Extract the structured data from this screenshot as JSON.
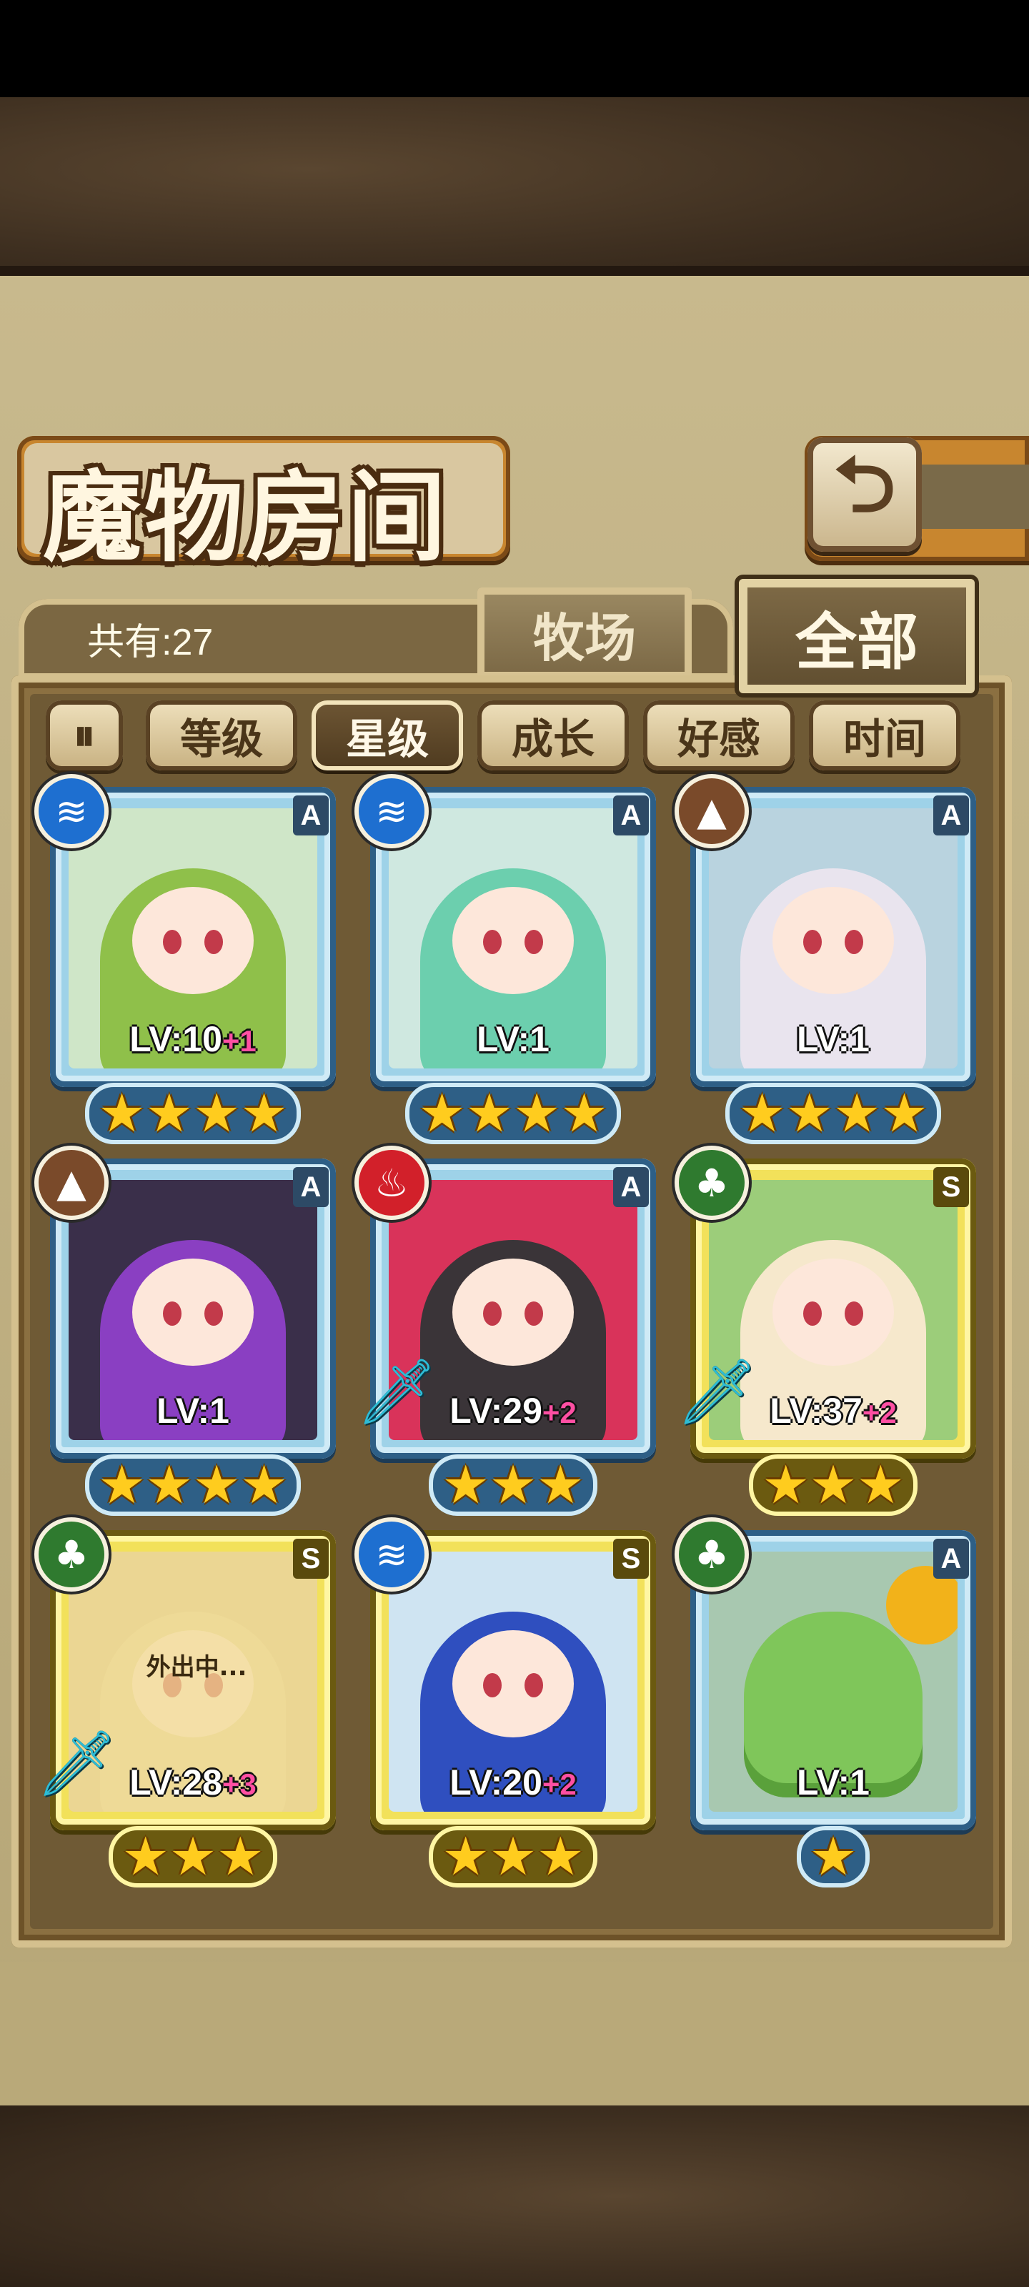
{
  "title": "魔物房间",
  "back_icon": "back-arrow-icon",
  "count_text": "共有:27",
  "tabs": [
    {
      "label": "牧场",
      "active": false
    },
    {
      "label": "全部",
      "active": true
    }
  ],
  "sort": {
    "toggle_icon": "sort-order-icon",
    "toggle_glyph": "⏸",
    "options": [
      {
        "label": "等级",
        "active": false
      },
      {
        "label": "星级",
        "active": true
      },
      {
        "label": "成长",
        "active": false
      },
      {
        "label": "好感",
        "active": false
      },
      {
        "label": "时间",
        "active": false
      }
    ]
  },
  "colors": {
    "accent": "#c8862f",
    "panel": "#6f5a35",
    "plus": "#ff4fa3",
    "star": "#ffcc1e"
  },
  "monsters": [
    {
      "element": "water",
      "rank": "A",
      "frame": "blue",
      "lv": "LV:10",
      "plus": "+1",
      "stars": 4,
      "art_bg": "#cfe6c8",
      "hair": "#8fc04a",
      "weapon": false,
      "away": false
    },
    {
      "element": "water",
      "rank": "A",
      "frame": "blue",
      "lv": "LV:1",
      "plus": "",
      "stars": 4,
      "art_bg": "#cfe8e0",
      "hair": "#6ccfae",
      "weapon": false,
      "away": false
    },
    {
      "element": "earth",
      "rank": "A",
      "frame": "blue",
      "lv": "LV:1",
      "plus": "",
      "stars": 4,
      "art_bg": "#b9d3df",
      "hair": "#e9e4ee",
      "weapon": false,
      "away": false
    },
    {
      "element": "earth",
      "rank": "A",
      "frame": "blue",
      "lv": "LV:1",
      "plus": "",
      "stars": 4,
      "art_bg": "#3a2f4a",
      "hair": "#8a3fc2",
      "weapon": false,
      "away": false
    },
    {
      "element": "fire",
      "rank": "A",
      "frame": "blue",
      "lv": "LV:29",
      "plus": "+2",
      "stars": 3,
      "art_bg": "#d9335a",
      "hair": "#3a3438",
      "weapon": true,
      "away": false
    },
    {
      "element": "wood",
      "rank": "S",
      "frame": "gold",
      "lv": "LV:37",
      "plus": "+2",
      "stars": 3,
      "art_bg": "#9ccd7a",
      "hair": "#f6e8cc",
      "weapon": true,
      "away": false
    },
    {
      "element": "wood",
      "rank": "S",
      "frame": "gold",
      "lv": "LV:28",
      "plus": "+3",
      "stars": 3,
      "art_bg": "#d9c48a",
      "hair": "#e8d49a",
      "weapon": true,
      "away": true,
      "away_text": "外出中..."
    },
    {
      "element": "water",
      "rank": "S",
      "frame": "gold",
      "lv": "LV:20",
      "plus": "+2",
      "stars": 3,
      "art_bg": "#cfe4f2",
      "hair": "#2f4fbf",
      "weapon": false,
      "away": false
    },
    {
      "element": "wood",
      "rank": "A",
      "frame": "blue",
      "lv": "LV:1",
      "plus": "",
      "stars": 1,
      "art_bg": "#a8c8b0",
      "hair": "#7fc65a",
      "weapon": false,
      "away": false,
      "blob": true
    }
  ]
}
